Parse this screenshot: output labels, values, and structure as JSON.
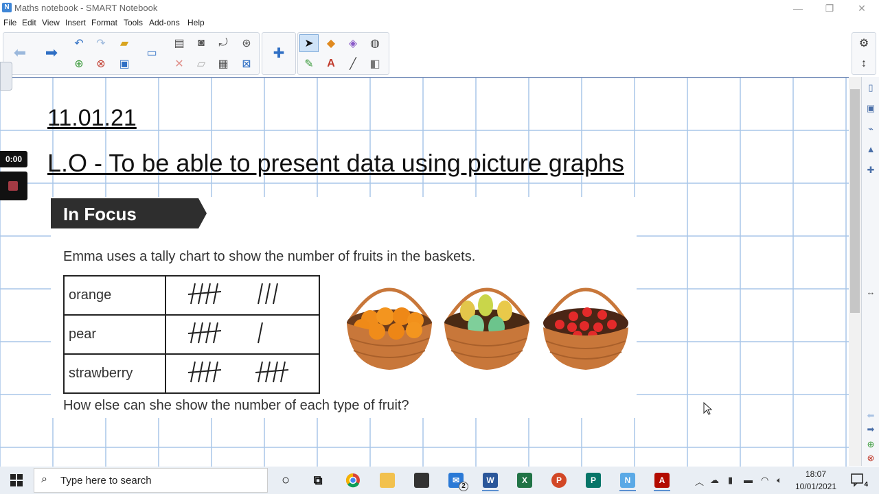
{
  "window": {
    "title": "Maths notebook - SMART Notebook",
    "minimize": "—",
    "restore": "❐",
    "close": "✕"
  },
  "menu": [
    "File",
    "Edit",
    "View",
    "Insert",
    "Format",
    "Tools",
    "Add-ons",
    "Help"
  ],
  "page": {
    "date": "11.01.21",
    "learning_objective": "L.O - To be able to present data using picture graphs"
  },
  "slide": {
    "banner": "In Focus",
    "question1": "Emma uses a tally chart to show the number of fruits in the baskets.",
    "question2": "How else can she show the number of each type of fruit?",
    "tally_rows": [
      {
        "fruit": "orange",
        "tally": 8
      },
      {
        "fruit": "pear",
        "tally": 6
      },
      {
        "fruit": "strawberry",
        "tally": 10
      }
    ]
  },
  "recorder": {
    "time": "0:00"
  },
  "taskbar": {
    "search_placeholder": "Type here to search",
    "time": "18:07",
    "date": "10/01/2021",
    "mail_badge": "2",
    "notification_badge": "4"
  },
  "colors": {
    "grid": "#a9c6e8",
    "toolbar_selected": "#cfe3f8",
    "recorder_dot": "#a33a44",
    "taskbar": "#e9eef4"
  }
}
